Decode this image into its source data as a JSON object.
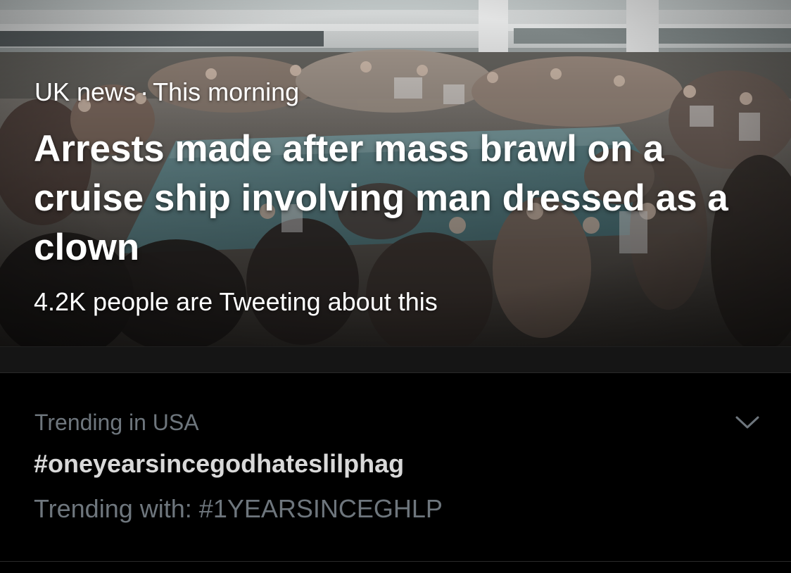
{
  "news_card": {
    "category": "UK news",
    "separator": "·",
    "time": "This morning",
    "headline": "Arrests made after mass brawl on a cruise ship involving man dressed as a clown",
    "social_proof": "4.2K people are Tweeting about this",
    "photo_subject": "crowd around a cruise ship pool deck"
  },
  "trend": {
    "context": "Trending in USA",
    "hashtag": "#oneyearsincegodhateslilphag",
    "with_prefix": "Trending with:",
    "with_hashtag": "#1YEARSINCEGHLP",
    "menu_icon": "chevron-down-icon"
  },
  "colors": {
    "background": "#000000",
    "divider_band": "#151515",
    "muted_text": "#6e767d",
    "primary_text": "#d9d9d9",
    "white": "#ffffff"
  }
}
